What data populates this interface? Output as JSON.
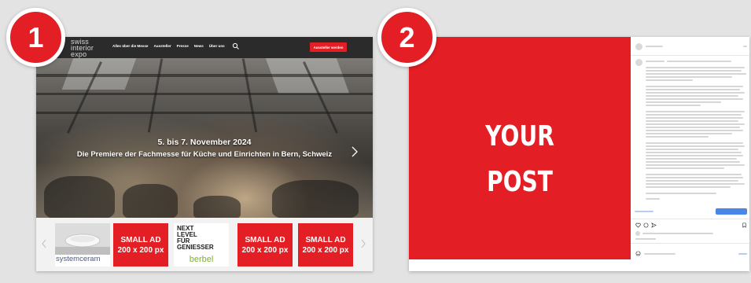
{
  "badges": {
    "one": "1",
    "two": "2"
  },
  "website": {
    "logo": [
      "swiss",
      "interior",
      "expo"
    ],
    "nav": [
      "Alles über die Messe",
      "Aussteller",
      "Presse",
      "News",
      "Über uns"
    ],
    "cta": "Aussteller werden",
    "hero": {
      "date": "5. bis 7. November 2024",
      "subtitle": "Die Premiere der Fachmesse für Küche und Einrichten in Bern, Schweiz"
    },
    "ads": {
      "systemceram": "systemceram",
      "small_ad_title": "SMALL AD",
      "small_ad_size": "200 x 200 px",
      "berbel_text": [
        "NEXT",
        "LEVEL",
        "FÜR",
        "GENIESSER"
      ],
      "berbel_logo": "berbel"
    }
  },
  "post": {
    "line1": "YOUR",
    "line2": "POST"
  },
  "colors": {
    "accent": "#e31e24",
    "link": "#3b6fd8",
    "berbel_green": "#7cb32a"
  },
  "icons": [
    "search-icon",
    "chevron-right-icon",
    "chevron-left-icon",
    "chevron-down-icon",
    "heart-icon",
    "comment-icon",
    "share-icon",
    "bookmark-icon",
    "smiley-icon"
  ]
}
